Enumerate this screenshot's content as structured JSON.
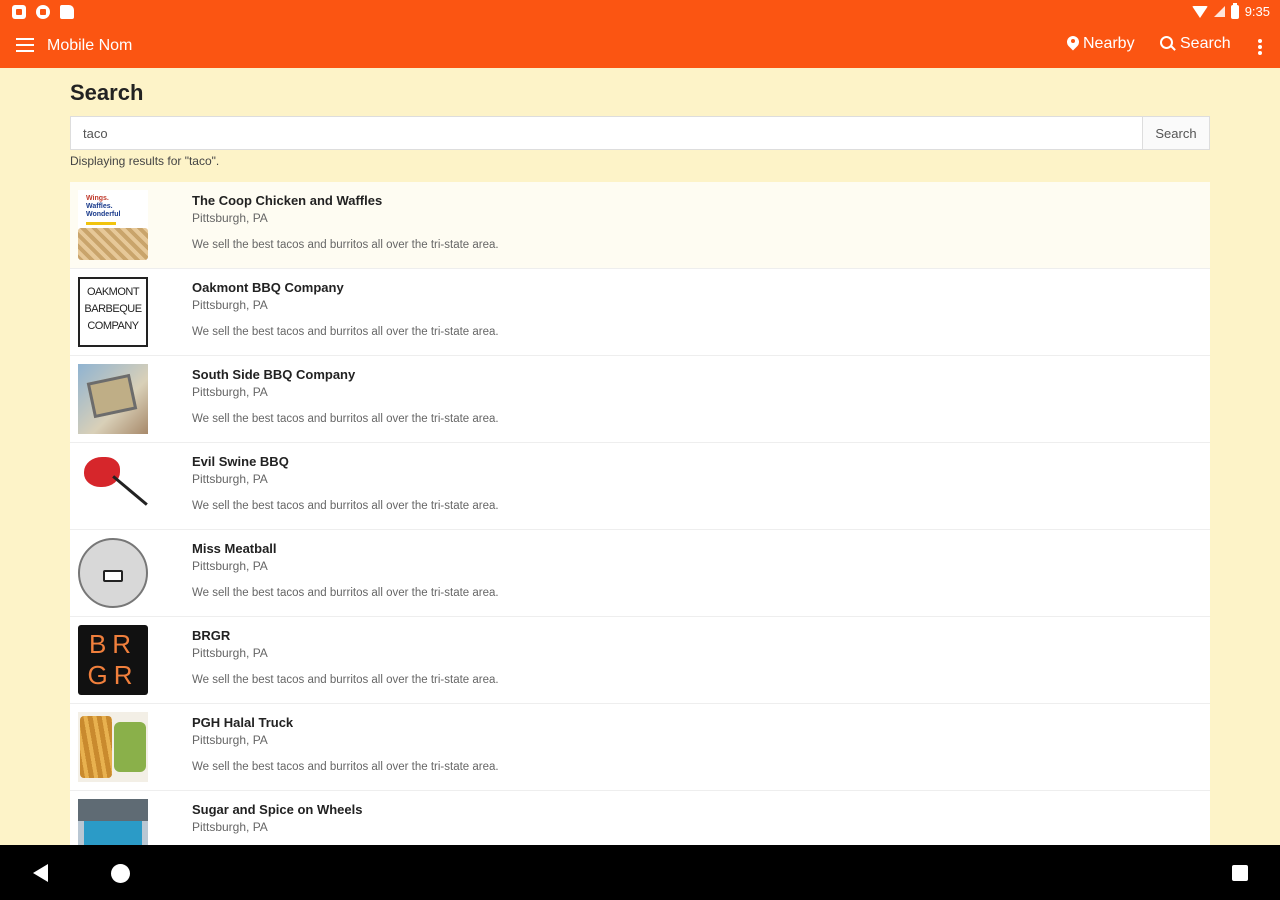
{
  "status_bar": {
    "time": "9:35"
  },
  "app_bar": {
    "title": "Mobile Nom",
    "nearby_label": "Nearby",
    "search_label": "Search"
  },
  "page": {
    "title": "Search",
    "search_value": "taco",
    "search_button": "Search",
    "results_text": "Displaying results for \"taco\"."
  },
  "results": [
    {
      "name": "The Coop Chicken and Waffles",
      "location": "Pittsburgh, PA",
      "description": "We sell the best tacos and burritos all over the tri-state area."
    },
    {
      "name": "Oakmont BBQ Company",
      "location": "Pittsburgh, PA",
      "description": "We sell the best tacos and burritos all over the tri-state area."
    },
    {
      "name": "South Side BBQ Company",
      "location": "Pittsburgh, PA",
      "description": "We sell the best tacos and burritos all over the tri-state area."
    },
    {
      "name": "Evil Swine BBQ",
      "location": "Pittsburgh, PA",
      "description": "We sell the best tacos and burritos all over the tri-state area."
    },
    {
      "name": "Miss Meatball",
      "location": "Pittsburgh, PA",
      "description": "We sell the best tacos and burritos all over the tri-state area."
    },
    {
      "name": "BRGR",
      "location": "Pittsburgh, PA",
      "description": "We sell the best tacos and burritos all over the tri-state area."
    },
    {
      "name": "PGH Halal Truck",
      "location": "Pittsburgh, PA",
      "description": "We sell the best tacos and burritos all over the tri-state area."
    },
    {
      "name": "Sugar and Spice on Wheels",
      "location": "Pittsburgh, PA",
      "description": ""
    }
  ],
  "logos": {
    "coop": [
      "Wings.",
      "Waffles.",
      "Wonderful"
    ],
    "oakmont": [
      "OAKMONT",
      "BARBEQUE",
      "COMPANY"
    ],
    "brgr": [
      "BR",
      "GR"
    ]
  },
  "colors": {
    "accent": "#fb5512",
    "background": "#fdf3c8",
    "nav_bar": "#000000"
  }
}
